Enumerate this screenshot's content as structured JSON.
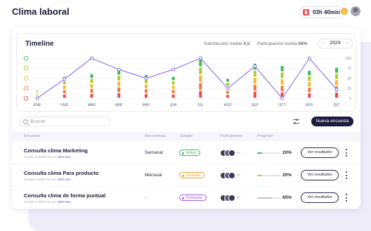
{
  "header": {
    "title": "Clima laboral",
    "timer": "03h 40min",
    "timer_icon": "stopwatch-icon",
    "mood_icon": "smiley-icon",
    "avatar_icon": "user-avatar"
  },
  "timeline": {
    "title": "Timeline",
    "satisfaction_label": "Satisfacción media",
    "satisfaction_value": "4,5",
    "participation_label": "Participación media",
    "participation_value": "68%",
    "year": "2024",
    "prev_icon": "chevron-left-icon",
    "next_icon": "chevron-right-icon"
  },
  "chart_data": {
    "type": "line",
    "categories": [
      "ENE",
      "FEB",
      "MAR",
      "ABR",
      "MAY",
      "JUN",
      "JUL",
      "AGO",
      "SEP",
      "OCT",
      "NOV",
      "DIC"
    ],
    "ylim": [
      0,
      100
    ],
    "yticks": [
      0,
      25,
      50,
      75,
      100
    ],
    "series": [
      {
        "values": [
          0,
          48,
          100,
          72,
          50,
          72,
          100,
          25,
          80,
          0,
          100,
          22
        ],
        "color": "#8b6cf0"
      }
    ],
    "satisfaction_levels_colors": [
      "#f04848",
      "#f47a3a",
      "#f6b731",
      "#a8cd2a",
      "#3bbd5a"
    ],
    "grid": true,
    "left_icons": [
      "very-happy-icon",
      "happy-icon",
      "neutral-icon",
      "sad-icon",
      "very-sad-icon"
    ]
  },
  "toolbar": {
    "search_placeholder": "Buscar",
    "search_icon": "search-icon",
    "filter_icon": "sliders-icon",
    "new_button": "Nueva encuesta"
  },
  "table": {
    "columns": [
      "Encuesta",
      "Recurrencia",
      "Estado",
      "Participantes",
      "Progreso"
    ],
    "rows": [
      {
        "name": "Consulta clima Marketing",
        "created": "Creado el 26/07/22 por",
        "author": "John Doe",
        "recurrence": "Semanal",
        "status": "Activa",
        "status_color": "#3bb85d",
        "participants_extra": "+⁴",
        "progress": 20,
        "progress_label": "20%",
        "progress_color": "#3bb85d",
        "action": "Ver resultados"
      },
      {
        "name": "Consulta clima Para producto",
        "created": "Creado el 26/07/22 por",
        "author": "John Doe",
        "recurrence": "Mensual",
        "status": "Pausada",
        "status_color": "#e9a12a",
        "participants_extra": "+⁴",
        "progress": 20,
        "progress_label": "20%",
        "progress_color": "#f2b531",
        "action": "Ver resultados"
      },
      {
        "name": "Consulta clima de forma puntual",
        "created": "Creado el 26/07/22 por",
        "author": "John Doe",
        "recurrence": "-",
        "status": "Finalizada",
        "status_color": "#a35ee0",
        "participants_extra": "+⁴",
        "progress": 65,
        "progress_label": "65%",
        "progress_color": "#c4c4d2",
        "action": "Ver resultados"
      }
    ]
  },
  "colors": {
    "accent": "#8b6cf0",
    "primary_dark": "#1d1c3e",
    "background_shape": "#eeecf8"
  }
}
